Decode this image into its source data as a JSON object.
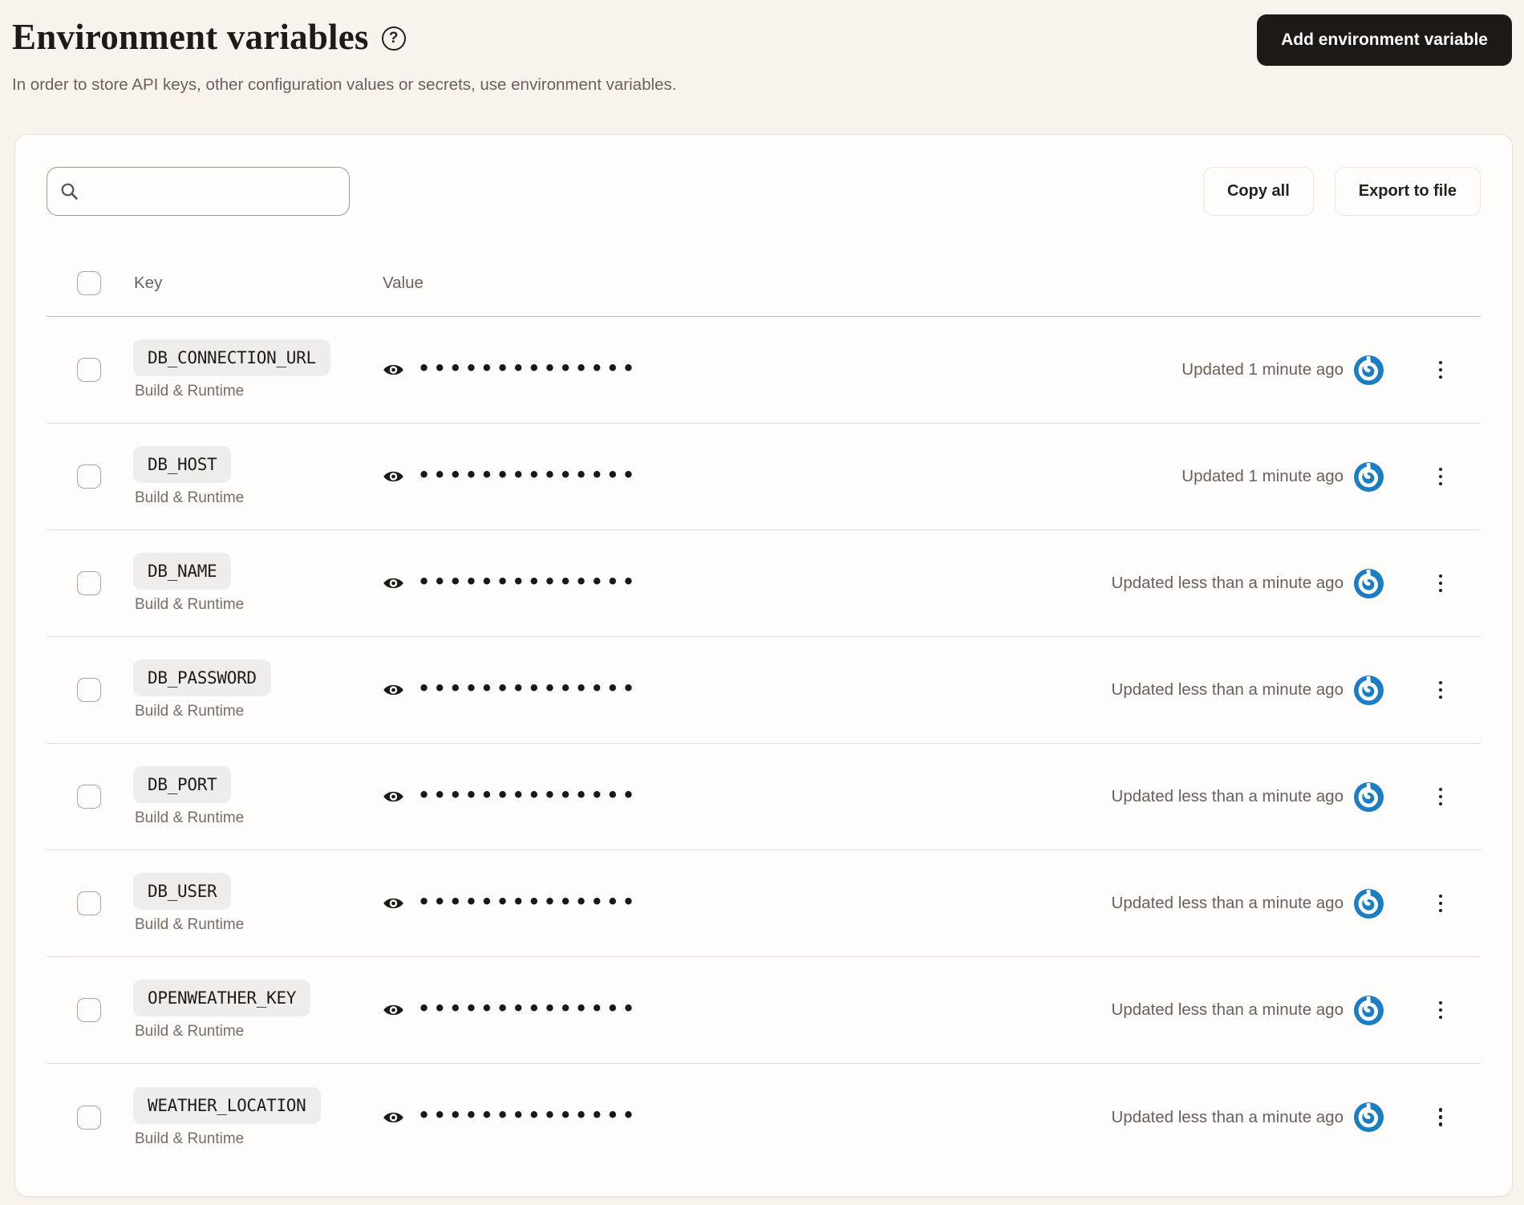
{
  "page": {
    "title": "Environment variables",
    "subtitle": "In order to store API keys, other configuration values or secrets, use environment variables.",
    "add_button_label": "Add environment variable"
  },
  "icons": {
    "help": "?",
    "search": "magnifier",
    "eye": "reveal-value",
    "service_logo": "blue-spiral-logo",
    "kebab": "vertical-dots-menu"
  },
  "toolbar": {
    "search_value": "",
    "search_placeholder": "",
    "copy_all_label": "Copy all",
    "export_label": "Export to file"
  },
  "table": {
    "columns": {
      "key": "Key",
      "value": "Value"
    },
    "value_mask": "••••••••••••••",
    "rows": [
      {
        "key": "DB_CONNECTION_URL",
        "scope": "Build & Runtime",
        "updated": "Updated 1 minute ago"
      },
      {
        "key": "DB_HOST",
        "scope": "Build & Runtime",
        "updated": "Updated 1 minute ago"
      },
      {
        "key": "DB_NAME",
        "scope": "Build & Runtime",
        "updated": "Updated less than a minute ago"
      },
      {
        "key": "DB_PASSWORD",
        "scope": "Build & Runtime",
        "updated": "Updated less than a minute ago"
      },
      {
        "key": "DB_PORT",
        "scope": "Build & Runtime",
        "updated": "Updated less than a minute ago"
      },
      {
        "key": "DB_USER",
        "scope": "Build & Runtime",
        "updated": "Updated less than a minute ago"
      },
      {
        "key": "OPENWEATHER_KEY",
        "scope": "Build & Runtime",
        "updated": "Updated less than a minute ago"
      },
      {
        "key": "WEATHER_LOCATION",
        "scope": "Build & Runtime",
        "updated": "Updated less than a minute ago"
      }
    ]
  },
  "colors": {
    "page_bg": "#f8f3ed",
    "card_bg": "#fffdfb",
    "accent_blue": "#1b7dc2",
    "primary_button_bg": "#1c1917",
    "muted_text": "#6e5f5d",
    "chip_bg": "#efedec",
    "divider": "#e7dbd3"
  }
}
